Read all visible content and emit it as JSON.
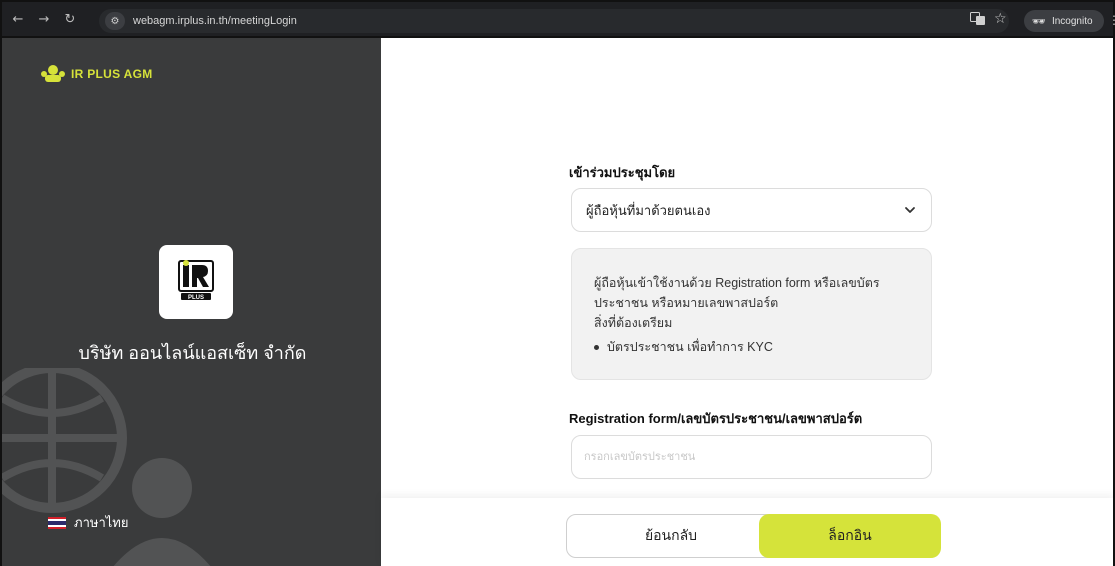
{
  "browser": {
    "url": "webagm.irplus.in.th/meetingLogin",
    "incognito_label": "Incognito"
  },
  "left": {
    "brand_text": "IR PLUS AGM",
    "company_name": "บริษัท ออนไลน์แอสเซ็ท จำกัด",
    "language_label": "ภาษาไทย"
  },
  "form": {
    "attend_label": "เข้าร่วมประชุมโดย",
    "attend_selected": "ผู้ถือหุ้นที่มาด้วยตนเอง",
    "info_line1": "ผู้ถือหุ้นเข้าใช้งานด้วย Registration form หรือเลขบัตร",
    "info_line2": "ประชาชน หรือหมายเลขพาสปอร์ต",
    "info_line3": "สิ่งที่ต้องเตรียม",
    "info_bullet": "บัตรประชาชน เพื่อทำการ KYC",
    "id_label": "Registration form/เลขบัตรประชาชน/เลขพาสปอร์ต",
    "id_placeholder": "กรอกเลขบัตรประชาชน"
  },
  "footer": {
    "back_label": "ย้อนกลับ",
    "login_label": "ล็อกอิน"
  },
  "colors": {
    "accent": "#d5e33a",
    "left_bg": "#3a3b3c"
  }
}
